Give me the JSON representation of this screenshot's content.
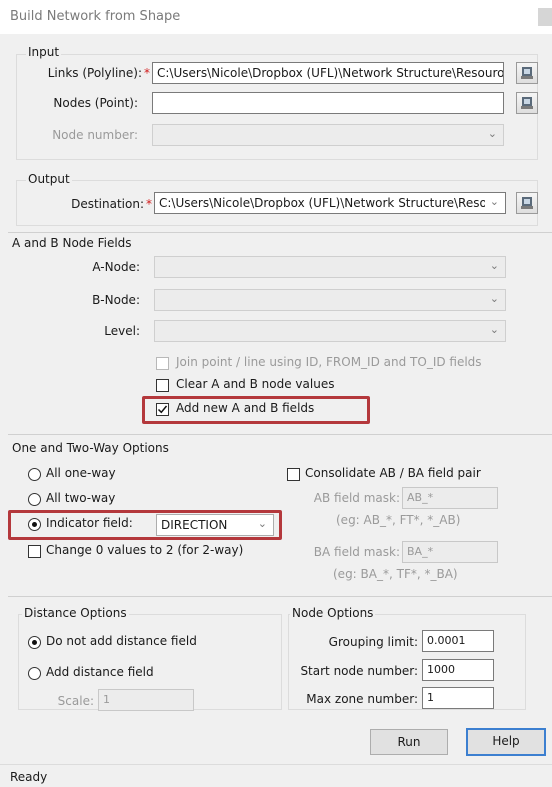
{
  "window": {
    "title": "Build Network from Shape"
  },
  "input": {
    "group_label": "Input",
    "links_label": "Links (Polyline):",
    "required_mark": "*",
    "links_value": "C:\\Users\\Nicole\\Dropbox (UFL)\\Network Structure\\Resouro",
    "nodes_label": "Nodes (Point):",
    "nodes_value": "",
    "node_number_label": "Node number:",
    "node_number_value": ""
  },
  "output": {
    "group_label": "Output",
    "destination_label": "Destination:",
    "required_mark": "*",
    "destination_value": "C:\\Users\\Nicole\\Dropbox (UFL)\\Network Structure\\Reso"
  },
  "ab_fields": {
    "group_label": "A and B Node Fields",
    "a_node_label": "A-Node:",
    "b_node_label": "B-Node:",
    "level_label": "Level:",
    "join_label": "Join point / line using ID, FROM_ID and TO_ID fields",
    "join_checked": false,
    "clear_label": "Clear A and B node values",
    "clear_checked": false,
    "add_label": "Add new A and B fields",
    "add_checked": true
  },
  "way_options": {
    "group_label": "One and Two-Way Options",
    "all_one_way": "All one-way",
    "all_two_way": "All two-way",
    "indicator_label": "Indicator field:",
    "indicator_value": "DIRECTION",
    "selected": "indicator",
    "change_label": "Change 0 values to 2 (for 2-way)",
    "change_checked": false,
    "consolidate_label": "Consolidate AB / BA field pair",
    "consolidate_checked": false,
    "ab_mask_label": "AB field mask:",
    "ab_mask_value": "AB_*",
    "ab_example": "(eg: AB_*, FT*, *_AB)",
    "ba_mask_label": "BA field mask:",
    "ba_mask_value": "BA_*",
    "ba_example": "(eg: BA_*, TF*, *_BA)"
  },
  "distance": {
    "group_label": "Distance Options",
    "no_distance": "Do not add distance field",
    "add_distance": "Add distance field",
    "selected": "no_distance",
    "scale_label": "Scale:",
    "scale_value": "1"
  },
  "node_options": {
    "group_label": "Node Options",
    "grouping_label": "Grouping limit:",
    "grouping_value": "0.0001",
    "start_label": "Start node number:",
    "start_value": "1000",
    "max_zone_label": "Max zone number:",
    "max_zone_value": "1"
  },
  "buttons": {
    "run": "Run",
    "help": "Help"
  },
  "status": {
    "text": "Ready"
  },
  "colors": {
    "highlight": "#b4383c",
    "required": "#d11a1a",
    "default_button_border": "#3c7fd0"
  }
}
